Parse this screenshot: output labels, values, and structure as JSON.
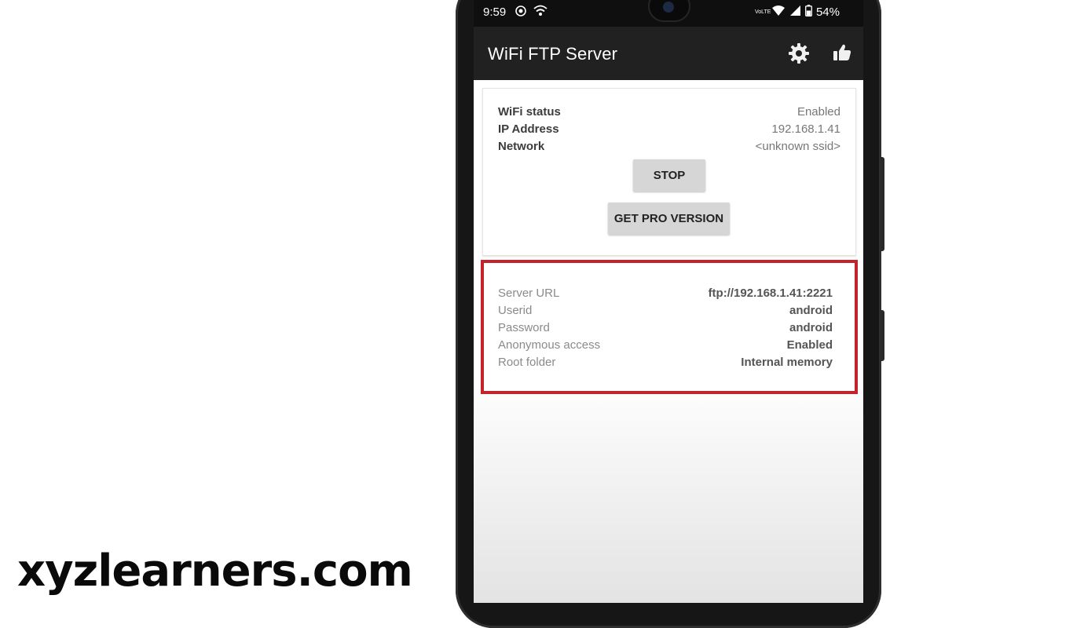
{
  "watermark": "xyzlearners.com",
  "status_bar": {
    "time": "9:59",
    "battery": "54%",
    "network_label": "VoLTE"
  },
  "app_bar": {
    "title": "WiFi FTP Server",
    "icons": [
      "gear-icon",
      "thumbs-up-icon"
    ]
  },
  "status_card": {
    "rows": [
      {
        "label": "WiFi status",
        "value": "Enabled"
      },
      {
        "label": "IP Address",
        "value": "192.168.1.41"
      },
      {
        "label": "Network",
        "value": "<unknown ssid>"
      }
    ],
    "stop_label": "STOP",
    "pro_label": "GET PRO VERSION"
  },
  "server_info": {
    "rows": [
      {
        "label": "Server URL",
        "value": "ftp://192.168.1.41:2221"
      },
      {
        "label": "Userid",
        "value": "android"
      },
      {
        "label": "Password",
        "value": "android"
      },
      {
        "label": "Anonymous access",
        "value": "Enabled"
      },
      {
        "label": "Root folder",
        "value": "Internal memory"
      }
    ]
  },
  "colors": {
    "app_bar": "#212121",
    "highlight": "#c4232b",
    "button": "#d6d6d6"
  }
}
